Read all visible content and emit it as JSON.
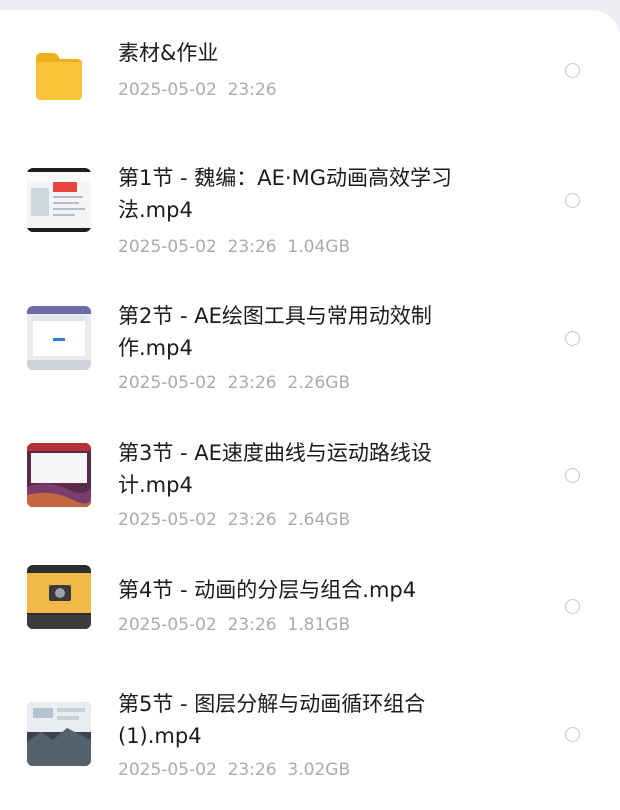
{
  "files": [
    {
      "name": "素材&作业",
      "date": "2025-05-02",
      "time": "23:26",
      "size": "",
      "icon": "folder-icon"
    },
    {
      "name": "第1节 - 魏编：AE·MG动画高效学习\n法.mp4",
      "date": "2025-05-02",
      "time": "23:26",
      "size": "1.04GB",
      "icon": "video-thumbnail"
    },
    {
      "name": "第2节 - AE绘图工具与常用动效制\n作.mp4",
      "date": "2025-05-02",
      "time": "23:26",
      "size": "2.26GB",
      "icon": "video-thumbnail"
    },
    {
      "name": "第3节 - AE速度曲线与运动路线设\n计.mp4",
      "date": "2025-05-02",
      "time": "23:26",
      "size": "2.64GB",
      "icon": "video-thumbnail"
    },
    {
      "name": "第4节 - 动画的分层与组合.mp4",
      "date": "2025-05-02",
      "time": "23:26",
      "size": "1.81GB",
      "icon": "video-thumbnail"
    },
    {
      "name": "第5节 - 图层分解与动画循环组合\n(1).mp4",
      "date": "2025-05-02",
      "time": "23:26",
      "size": "3.02GB",
      "icon": "video-thumbnail"
    }
  ],
  "colors": {
    "folder": "#f8c53a",
    "title_text": "#1b1b1b",
    "meta_text": "#a9abb1",
    "radio_border": "#c6c7cb"
  }
}
